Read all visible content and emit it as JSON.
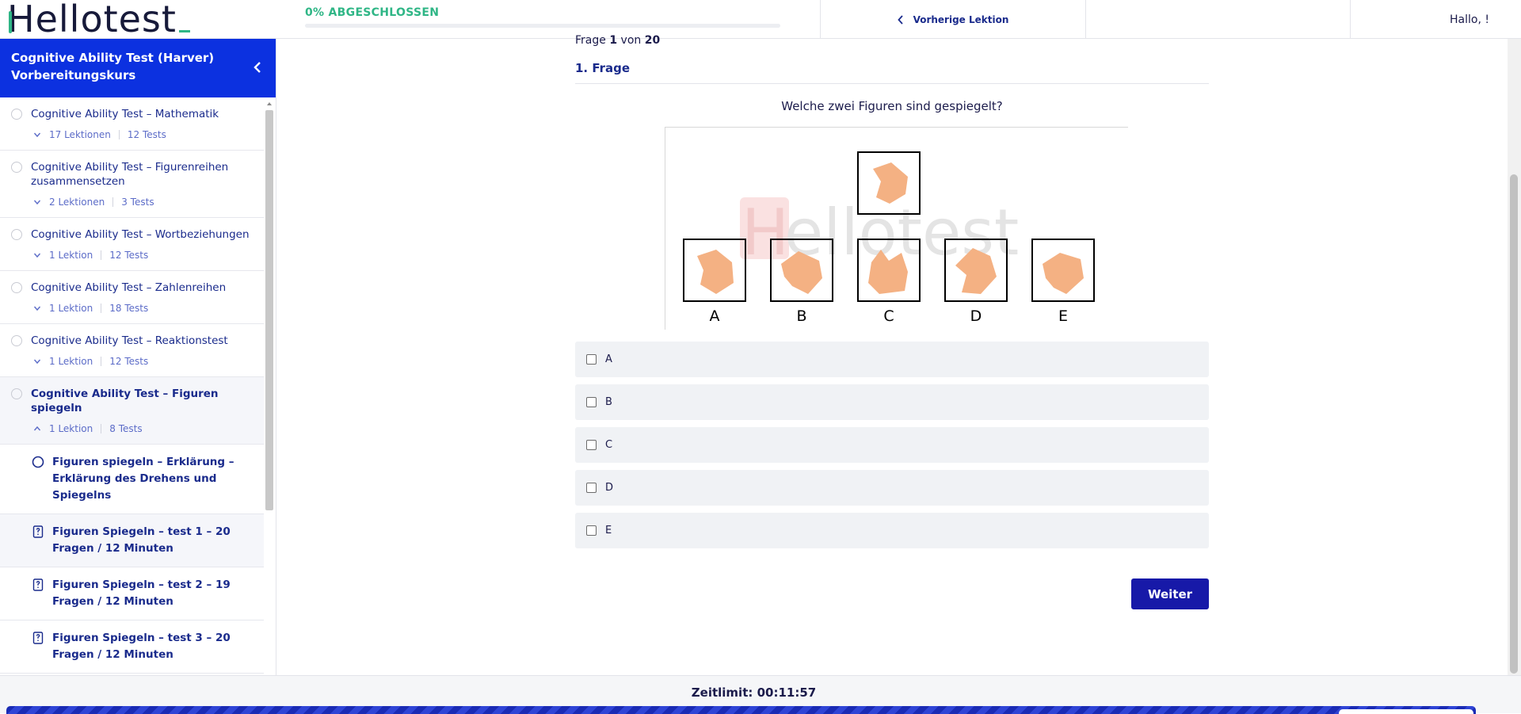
{
  "header": {
    "logo_text": "Hellotest",
    "progress_label": "0% ABGESCHLOSSEN",
    "progress_fraction": 0,
    "prev_lesson_label": "Vorherige Lektion",
    "greeting": "Hallo, !"
  },
  "sidebar": {
    "course_title": "Cognitive Ability Test (Harver) Vorbereitungskurs",
    "sections": [
      {
        "title": "Cognitive Ability Test – Mathematik",
        "lessons": "17 Lektionen",
        "tests": "12 Tests"
      },
      {
        "title": "Cognitive Ability Test – Figurenreihen zusammensetzen",
        "lessons": "2 Lektionen",
        "tests": "3 Tests"
      },
      {
        "title": "Cognitive Ability Test – Wortbeziehungen",
        "lessons": "1 Lektion",
        "tests": "12 Tests"
      },
      {
        "title": "Cognitive Ability Test – Zahlenreihen",
        "lessons": "1 Lektion",
        "tests": "18 Tests"
      },
      {
        "title": "Cognitive Ability Test – Reaktionstest",
        "lessons": "1 Lektion",
        "tests": "12 Tests"
      },
      {
        "title": "Cognitive Ability Test – Figuren spiegeln",
        "lessons": "1 Lektion",
        "tests": "8 Tests"
      }
    ],
    "lessons": [
      {
        "title": "Figuren spiegeln – Erklärung – Erklärung des Drehens und Spiegelns",
        "icon": "circle-icon"
      },
      {
        "title": "Figuren Spiegeln – test 1 – 20 Fragen / 12 Minuten",
        "icon": "quiz-icon"
      },
      {
        "title": "Figuren Spiegeln – test 2 – 19 Fragen / 12 Minuten",
        "icon": "quiz-icon"
      },
      {
        "title": "Figuren Spiegeln – test 3 – 20 Fragen / 12 Minuten",
        "icon": "quiz-icon"
      }
    ]
  },
  "question": {
    "counter_prefix": "Frage",
    "counter_current": "1",
    "counter_mid": "von",
    "counter_total": "20",
    "label": "1. Frage",
    "text": "Welche zwei Figuren sind gespiegelt?",
    "figure_labels": [
      "A",
      "B",
      "C",
      "D",
      "E"
    ],
    "watermark": "Hellotest",
    "shape_color": "#f4b183",
    "options": [
      "A",
      "B",
      "C",
      "D",
      "E"
    ],
    "next_label": "Weiter"
  },
  "footer": {
    "timer": "Zeitlimit: 00:11:57"
  },
  "colors": {
    "brand_blue": "#0c31e0",
    "accent_green": "#2fb686",
    "button_blue": "#1719a8",
    "text_navy": "#1a2b8c"
  }
}
